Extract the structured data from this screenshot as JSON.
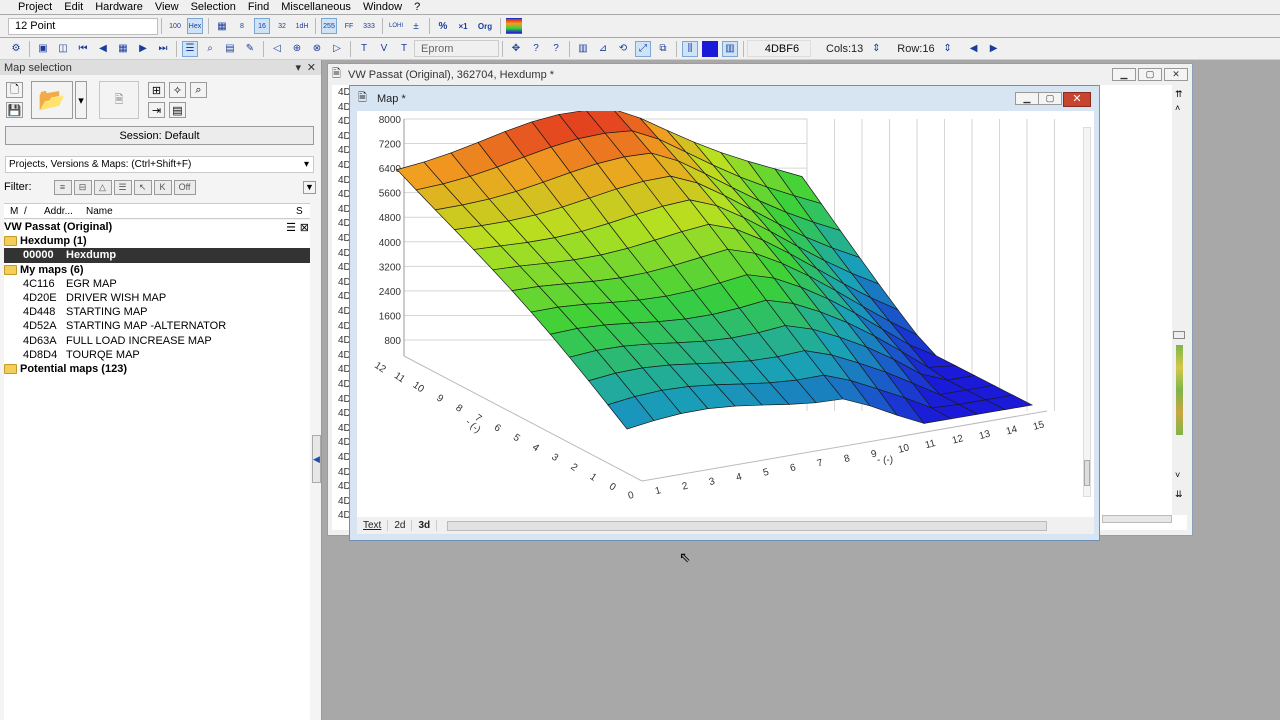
{
  "menu": [
    "Project",
    "Edit",
    "Hardware",
    "View",
    "Selection",
    "Find",
    "Miscellaneous",
    "Window",
    "?"
  ],
  "toolbar": {
    "font_size": "12 Point",
    "mode": "Eprom",
    "address": "4DBF6",
    "cols": "Cols:13",
    "row": "Row:16",
    "icon_100": "100",
    "icon_hex": "Hex",
    "icon_1dh": "1dH",
    "icon_255": "255",
    "icon_ff": "FF",
    "icon_333": "333",
    "icon_lohi": "LOHI",
    "icon_pct": "%",
    "icon_x1": "×1",
    "icon_org": "Org",
    "icon_8": "8",
    "icon_16": "16",
    "icon_32": "32"
  },
  "left_panel": {
    "title": "Map selection",
    "session": "Session: Default",
    "search": "Projects, Versions & Maps:  (Ctrl+Shift+F)",
    "filter_label": "Filter:",
    "filter_off": "Off",
    "cols": {
      "m": "M",
      "slash": "/",
      "addr": "Addr...",
      "name": "Name",
      "s": "S"
    },
    "project": "VW Passat (Original)",
    "hexdump_folder": "Hexdump (1)",
    "hexdump_item": {
      "addr": "00000",
      "name": "Hexdump"
    },
    "mymaps_folder": "My maps (6)",
    "maps": [
      {
        "addr": "4C116",
        "name": "EGR MAP"
      },
      {
        "addr": "4D20E",
        "name": "DRIVER WISH MAP"
      },
      {
        "addr": "4D448",
        "name": "STARTING MAP"
      },
      {
        "addr": "4D52A",
        "name": "STARTING MAP -ALTERNATOR"
      },
      {
        "addr": "4D63A",
        "name": "FULL LOAD INCREASE MAP"
      },
      {
        "addr": "4D8D4",
        "name": "TOURQE MAP"
      }
    ],
    "potential_folder": "Potential maps (123)"
  },
  "hexwin": {
    "title": "VW Passat (Original), 362704, Hexdump *",
    "addr_prefix": "4D"
  },
  "mapwin": {
    "title": "Map *",
    "tabs": [
      "Text",
      "2d",
      "3d"
    ]
  },
  "chart_data": {
    "type": "surface",
    "zlim": [
      0,
      8000
    ],
    "zticks": [
      "8000",
      "7200",
      "6400",
      "5600",
      "4800",
      "4000",
      "3200",
      "2400",
      "1600",
      "800"
    ],
    "xlabel": "- (-)",
    "ylabel": "- (-)",
    "xticks": [
      "0",
      "1",
      "2",
      "3",
      "4",
      "5",
      "6",
      "7",
      "8",
      "9",
      "10",
      "11",
      "12",
      "13",
      "14",
      "15"
    ],
    "yticks": [
      "0",
      "1",
      "2",
      "3",
      "4",
      "5",
      "6",
      "7",
      "8",
      "9",
      "10",
      "11",
      "12"
    ],
    "colormap": [
      "#1a1ad8",
      "#1aa0b8",
      "#3ad03a",
      "#b8e020",
      "#f0a020",
      "#e02020"
    ]
  }
}
